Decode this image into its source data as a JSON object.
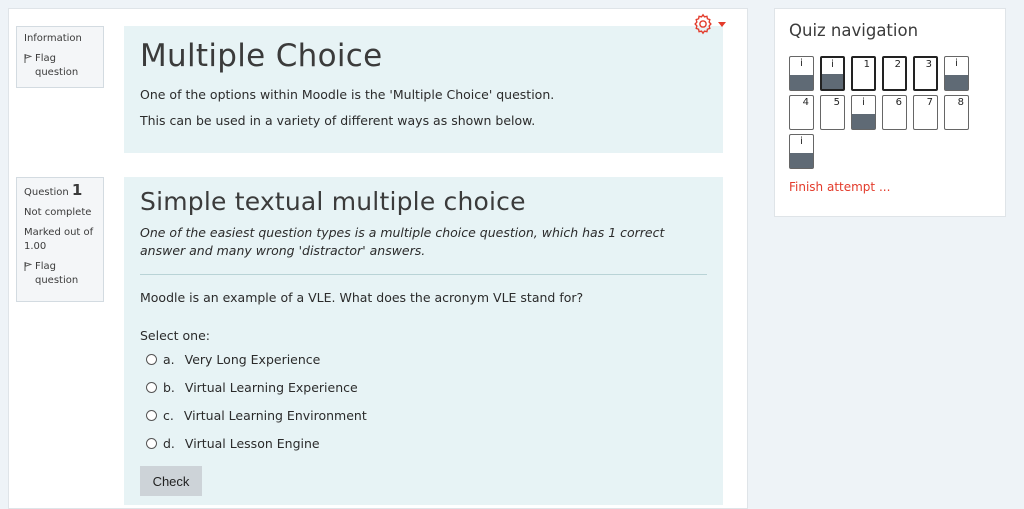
{
  "info_box": {
    "label": "Information",
    "flag_label": "Flag question"
  },
  "intro": {
    "title": "Multiple Choice",
    "lines": [
      "One of the options within Moodle is the 'Multiple Choice' question.",
      "This can be used in a variety of different ways as shown below."
    ]
  },
  "question_box": {
    "label": "Question",
    "number": "1",
    "status": "Not complete",
    "marked": "Marked out of 1.00",
    "flag_label": "Flag question"
  },
  "question": {
    "title": "Simple textual multiple choice",
    "intro": "One of the easiest question types is a multiple choice question, which has 1 correct answer and many wrong 'distractor' answers.",
    "text": "Moodle is an example of a VLE. What does the acronym VLE stand for?",
    "prompt": "Select one:",
    "answers": [
      {
        "letter": "a.",
        "text": "Very Long Experience"
      },
      {
        "letter": "b.",
        "text": "Virtual Learning Experience"
      },
      {
        "letter": "c.",
        "text": "Virtual Learning Environment"
      },
      {
        "letter": "d.",
        "text": "Virtual Lesson Engine"
      }
    ],
    "check_label": "Check"
  },
  "quiz_nav": {
    "title": "Quiz navigation",
    "buttons": [
      {
        "label": "i",
        "type": "info",
        "filled": true
      },
      {
        "label": "i",
        "type": "info",
        "filled": true,
        "current": true
      },
      {
        "label": "1",
        "type": "question",
        "current": true
      },
      {
        "label": "2",
        "type": "question",
        "current": true
      },
      {
        "label": "3",
        "type": "question",
        "current": true
      },
      {
        "label": "i",
        "type": "info",
        "filled": true
      },
      {
        "label": "4",
        "type": "question"
      },
      {
        "label": "5",
        "type": "question"
      },
      {
        "label": "i",
        "type": "info",
        "filled": true
      },
      {
        "label": "6",
        "type": "question"
      },
      {
        "label": "7",
        "type": "question"
      },
      {
        "label": "8",
        "type": "question"
      },
      {
        "label": "i",
        "type": "info",
        "filled": true
      }
    ],
    "finish_label": "Finish attempt ..."
  },
  "icons": {
    "settings": "gear-icon",
    "flag": "flag-icon",
    "dropdown": "caret-down-icon"
  },
  "colors": {
    "accent": "#e33b2b",
    "content_bg": "#e7f3f5",
    "nav_fill": "#5f6a75"
  }
}
